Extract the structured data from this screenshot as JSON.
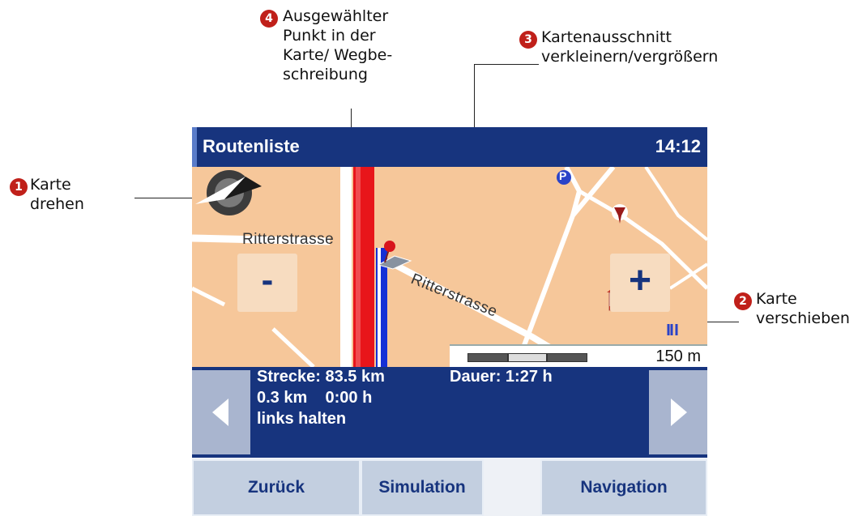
{
  "annotations": {
    "c1": {
      "num": "1",
      "text": "Karte\ndrehen"
    },
    "c2": {
      "num": "2",
      "text": "Karte\nverschieben"
    },
    "c3": {
      "num": "3",
      "text": "Kartenausschnitt\nverkleinern/vergrößern"
    },
    "c4": {
      "num": "4",
      "text": "Ausgewählter\nPunkt in der\nKarte/ Wegbe-\nschreibung"
    }
  },
  "screen": {
    "title": "Routenliste",
    "time": "14:12"
  },
  "map": {
    "street_label_1": "Ritterstrasse",
    "street_label_2": "Ritterstrasse",
    "zoom_out_label": "-",
    "zoom_in_label": "+",
    "scale": "150 m",
    "parking_label": "P",
    "compass_icon": "compass-rotate-icon",
    "poi_icons": [
      "wine-glass-icon",
      "church-icon",
      "restaurant-icon",
      "parking-icon",
      "location-pin-icon",
      "car-position-icon"
    ],
    "colors": {
      "background": "#f6c79a",
      "route": "#e8151a",
      "road_blue": "#1530d6",
      "roads": "#ffffff"
    }
  },
  "info": {
    "distance": "Strecke: 83.5 km",
    "duration": "Dauer: 1:27 h",
    "step_distance_time": "0.3 km    0:00 h",
    "instruction": "links halten",
    "prev_icon": "arrow-left-icon",
    "next_icon": "arrow-right-icon"
  },
  "buttons": {
    "back": "Zurück",
    "simulation": "Simulation",
    "navigation": "Navigation"
  },
  "colors": {
    "title_bar": "#17347e",
    "button_face": "#c3cfe0",
    "callout_badge": "#c0201a"
  }
}
